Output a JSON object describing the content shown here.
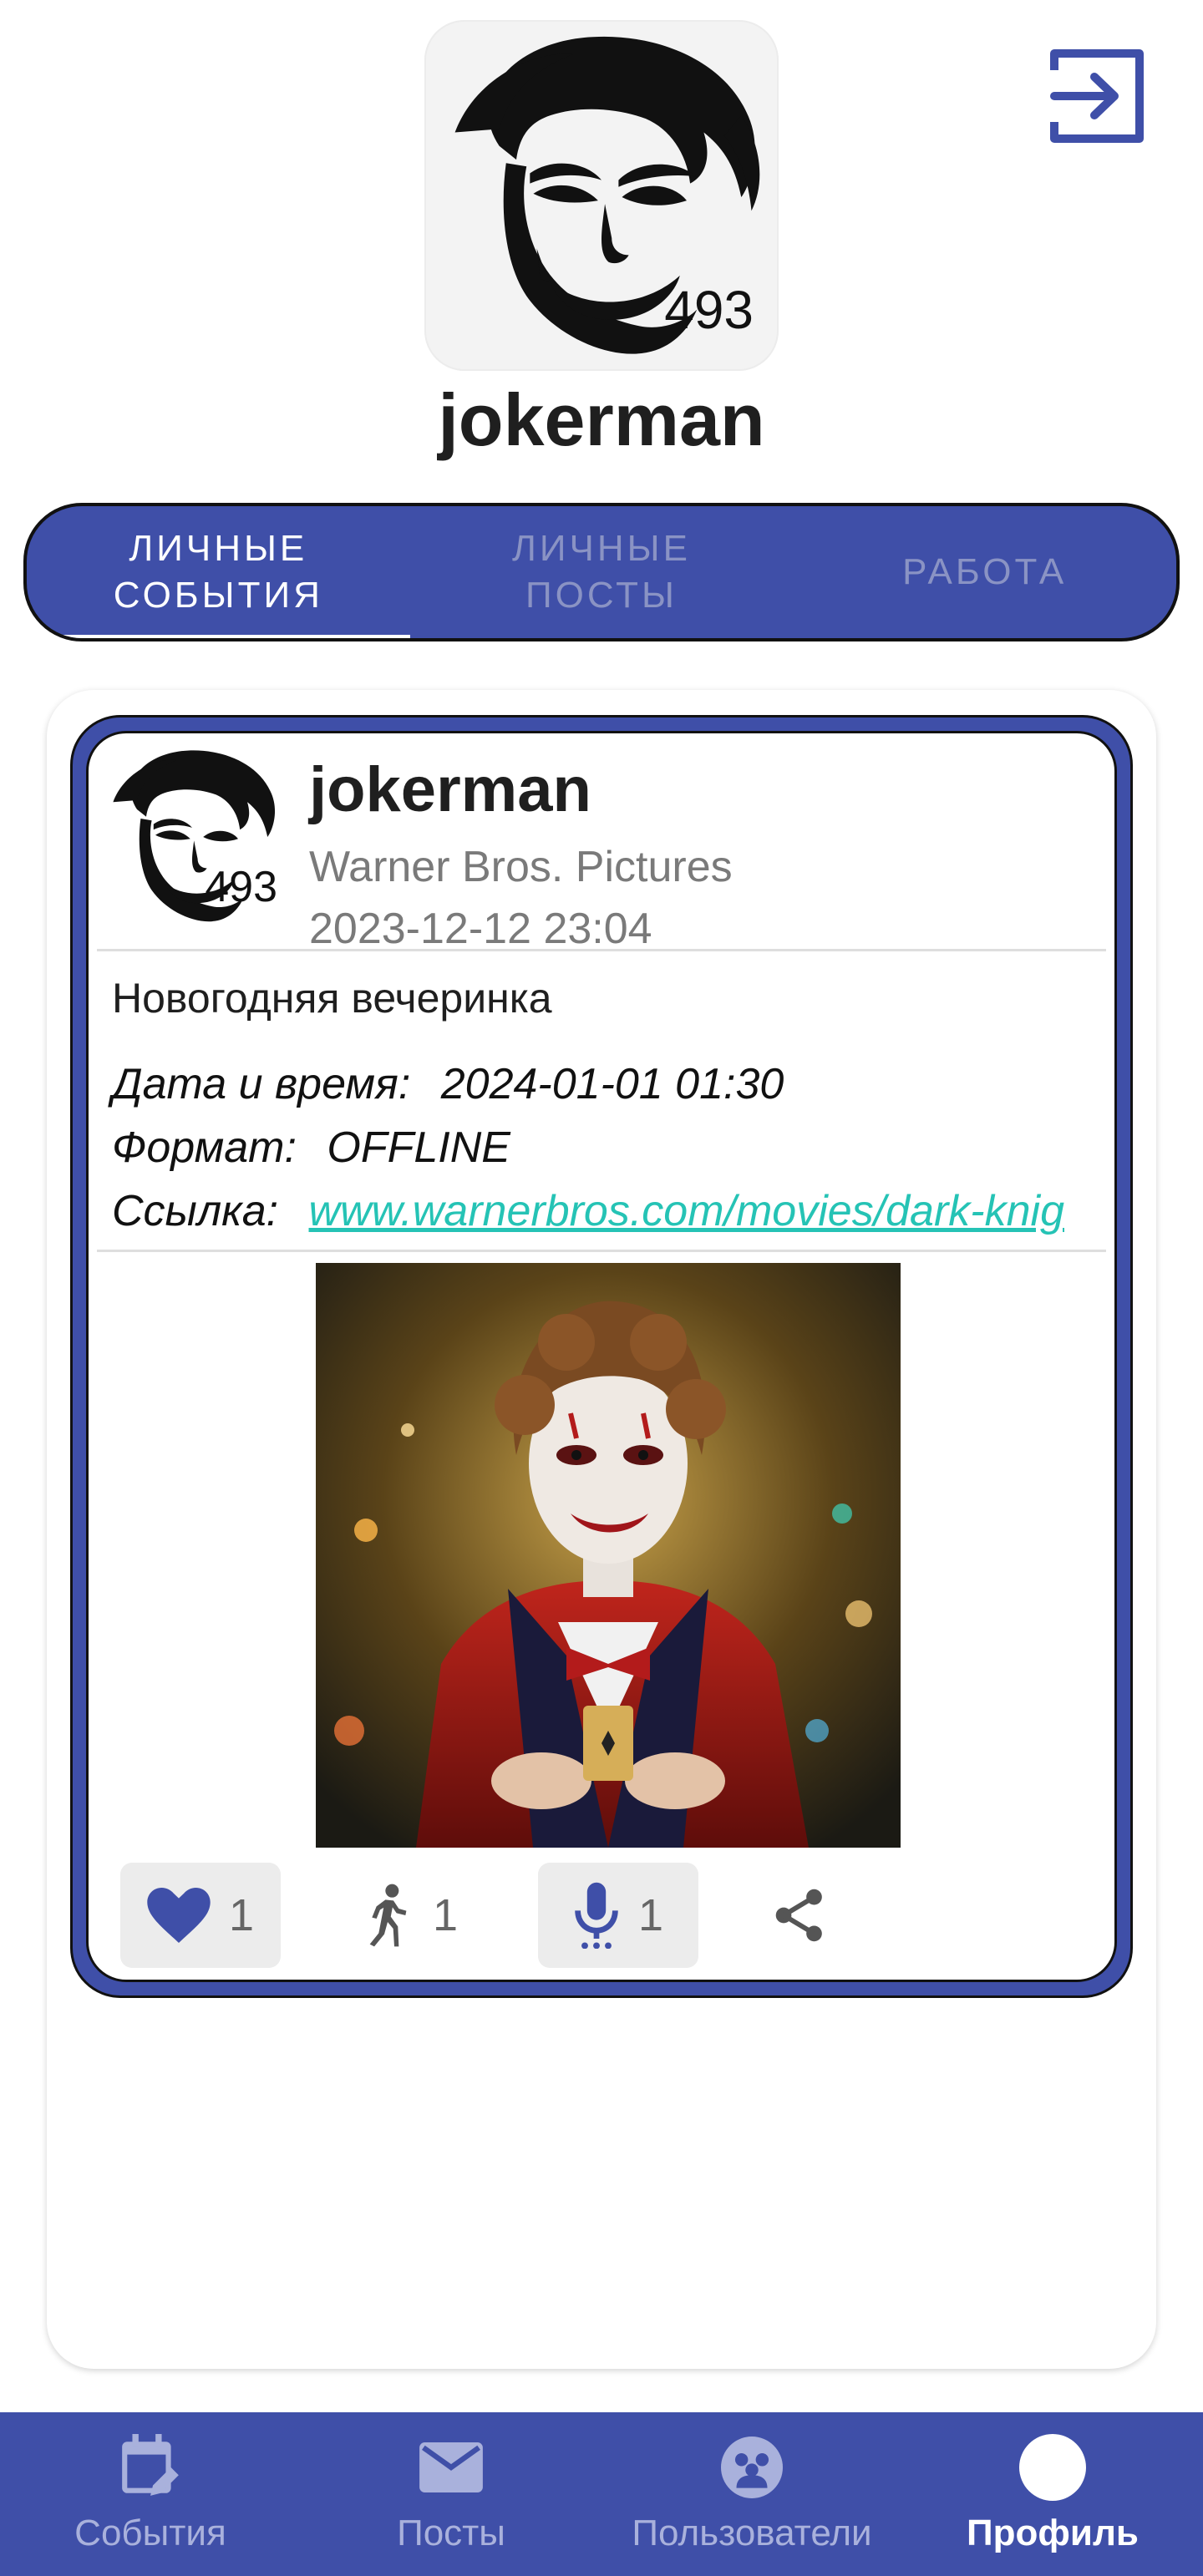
{
  "profile": {
    "username": "jokerman",
    "avatar_badge": "493",
    "logout_icon": "logout-icon"
  },
  "tabs": [
    {
      "label": "ЛИЧНЫЕ\nСОБЫТИЯ",
      "active": true
    },
    {
      "label": "ЛИЧНЫЕ\nПОСТЫ",
      "active": false
    },
    {
      "label": "РАБОТА",
      "active": false
    }
  ],
  "event": {
    "author": "jokerman",
    "avatar_badge": "493",
    "organization": "Warner Bros. Pictures",
    "posted_at": "2023-12-12 23:04",
    "title": "Новогодняя вечеринка",
    "datetime_label": "Дата и время:",
    "datetime_value": "2024-01-01 01:30",
    "format_label": "Формат:",
    "format_value": "OFFLINE",
    "link_label": "Ссылка:",
    "link_value": "www.warnerbros.com/movies/dark-knig",
    "actions": {
      "likes": "1",
      "participants": "1",
      "speakers": "1"
    }
  },
  "nav": [
    {
      "label": "События",
      "icon": "calendar-edit-icon"
    },
    {
      "label": "Посты",
      "icon": "mail-icon"
    },
    {
      "label": "Пользователи",
      "icon": "users-icon"
    },
    {
      "label": "Профиль",
      "icon": "profile-icon",
      "active": true
    }
  ],
  "colors": {
    "primary": "#3f4fa8",
    "link": "#25c3b5",
    "tab_inactive": "#8a93c4"
  }
}
